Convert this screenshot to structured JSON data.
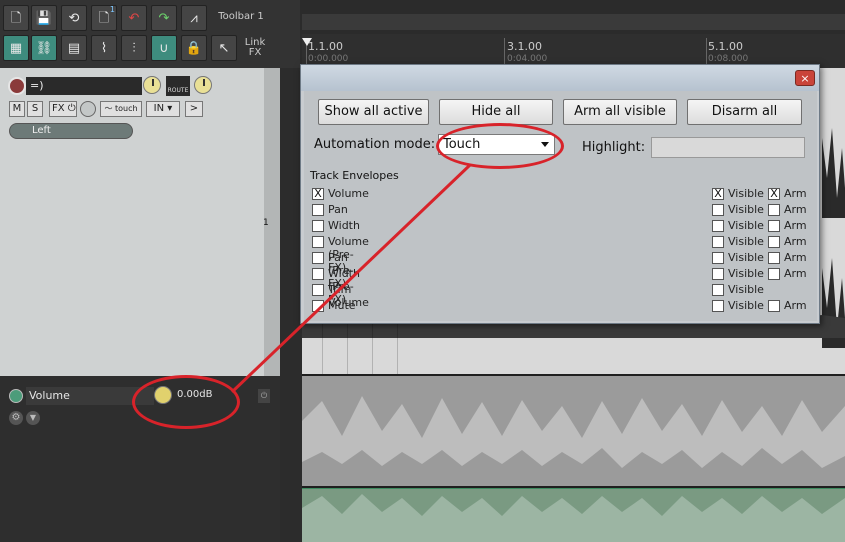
{
  "toolbar": {
    "label": "Toolbar 1",
    "link_label": "Link",
    "link_sub": "FX",
    "badge": "1"
  },
  "ruler": {
    "marks": [
      {
        "label": "1.1.00",
        "time": "0:00.000"
      },
      {
        "label": "3.1.00",
        "time": "0:04.000"
      },
      {
        "label": "5.1.00",
        "time": "0:08.000"
      }
    ]
  },
  "track": {
    "name": "=)",
    "route_label": "ROUTE",
    "mute": "M",
    "solo": "S",
    "fx": "FX",
    "automation_mode": "touch",
    "input": "IN",
    "input_channel": "Left",
    "track_number": "1"
  },
  "envelope_lane": {
    "name": "Volume",
    "value": "0.00dB"
  },
  "dialog": {
    "close_label": "×",
    "buttons": {
      "show_all_active": "Show all active",
      "hide_all": "Hide all",
      "arm_all_visible": "Arm all visible",
      "disarm_all": "Disarm all"
    },
    "automation_mode_label": "Automation mode:",
    "automation_mode_value": "Touch",
    "highlight_label": "Highlight:",
    "section_label": "Track Envelopes",
    "visible_label": "Visible",
    "arm_label": "Arm",
    "checked_mark": "X",
    "envelopes": [
      {
        "name": "Volume",
        "enabled": true,
        "visible": true,
        "arm": true,
        "has_arm": true
      },
      {
        "name": "Pan",
        "enabled": false,
        "visible": false,
        "arm": false,
        "has_arm": true
      },
      {
        "name": "Width",
        "enabled": false,
        "visible": false,
        "arm": false,
        "has_arm": true
      },
      {
        "name": "Volume (Pre-FX)",
        "enabled": false,
        "visible": false,
        "arm": false,
        "has_arm": true
      },
      {
        "name": "Pan (Pre-FX)",
        "enabled": false,
        "visible": false,
        "arm": false,
        "has_arm": true
      },
      {
        "name": "Width (Pre-FX)",
        "enabled": false,
        "visible": false,
        "arm": false,
        "has_arm": true
      },
      {
        "name": "Trim Volume",
        "enabled": false,
        "visible": false,
        "arm": false,
        "has_arm": false
      },
      {
        "name": "Mute",
        "enabled": false,
        "visible": false,
        "arm": false,
        "has_arm": true
      }
    ]
  },
  "colors": {
    "annotation": "#d8232a",
    "teal_button": "#3e8c7e",
    "envelope_lane": "#7a9a82"
  }
}
